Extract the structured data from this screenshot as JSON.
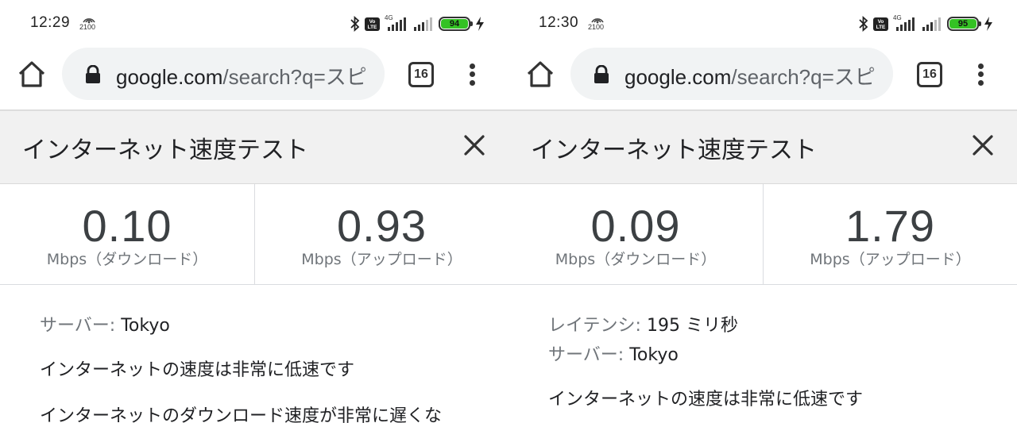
{
  "screens": [
    {
      "status": {
        "time": "12:29",
        "hotspot_label": "2100",
        "battery": "94",
        "network_label": "4G",
        "volte": "Vo LTE"
      },
      "browser": {
        "url_host": "google.com",
        "url_path": "/search?q=スピ",
        "tab_count": "16"
      },
      "card": {
        "title": "インターネット速度テスト"
      },
      "download": {
        "value": "0.10",
        "unit": "Mbps（ダウンロード）"
      },
      "upload": {
        "value": "0.93",
        "unit": "Mbps（アップロード）"
      },
      "details": {
        "server_label": "サーバー:",
        "server_value": " Tokyo",
        "message1": "インターネットの速度は非常に低速です",
        "message2": "インターネットのダウンロード速度が非常に遅くな"
      }
    },
    {
      "status": {
        "time": "12:30",
        "hotspot_label": "2100",
        "battery": "95",
        "network_label": "4G",
        "volte": "Vo LTE"
      },
      "browser": {
        "url_host": "google.com",
        "url_path": "/search?q=スピ",
        "tab_count": "16"
      },
      "card": {
        "title": "インターネット速度テスト"
      },
      "download": {
        "value": "0.09",
        "unit": "Mbps（ダウンロード）"
      },
      "upload": {
        "value": "1.79",
        "unit": "Mbps（アップロード）"
      },
      "details": {
        "latency_label": "レイテンシ:",
        "latency_value": " 195 ミリ秒",
        "server_label": "サーバー:",
        "server_value": " Tokyo",
        "message1": "インターネットの速度は非常に低速です"
      }
    }
  ],
  "colors": {
    "battery_fill": "#34c224",
    "card_header_bg": "#f1f1f1",
    "url_box_bg": "#f1f3f4"
  },
  "icons": [
    "home-icon",
    "lock-icon",
    "tab-switcher-icon",
    "more-vert-icon",
    "close-icon",
    "bluetooth-icon",
    "signal-icon",
    "battery-icon",
    "charging-icon",
    "hotspot-icon"
  ]
}
